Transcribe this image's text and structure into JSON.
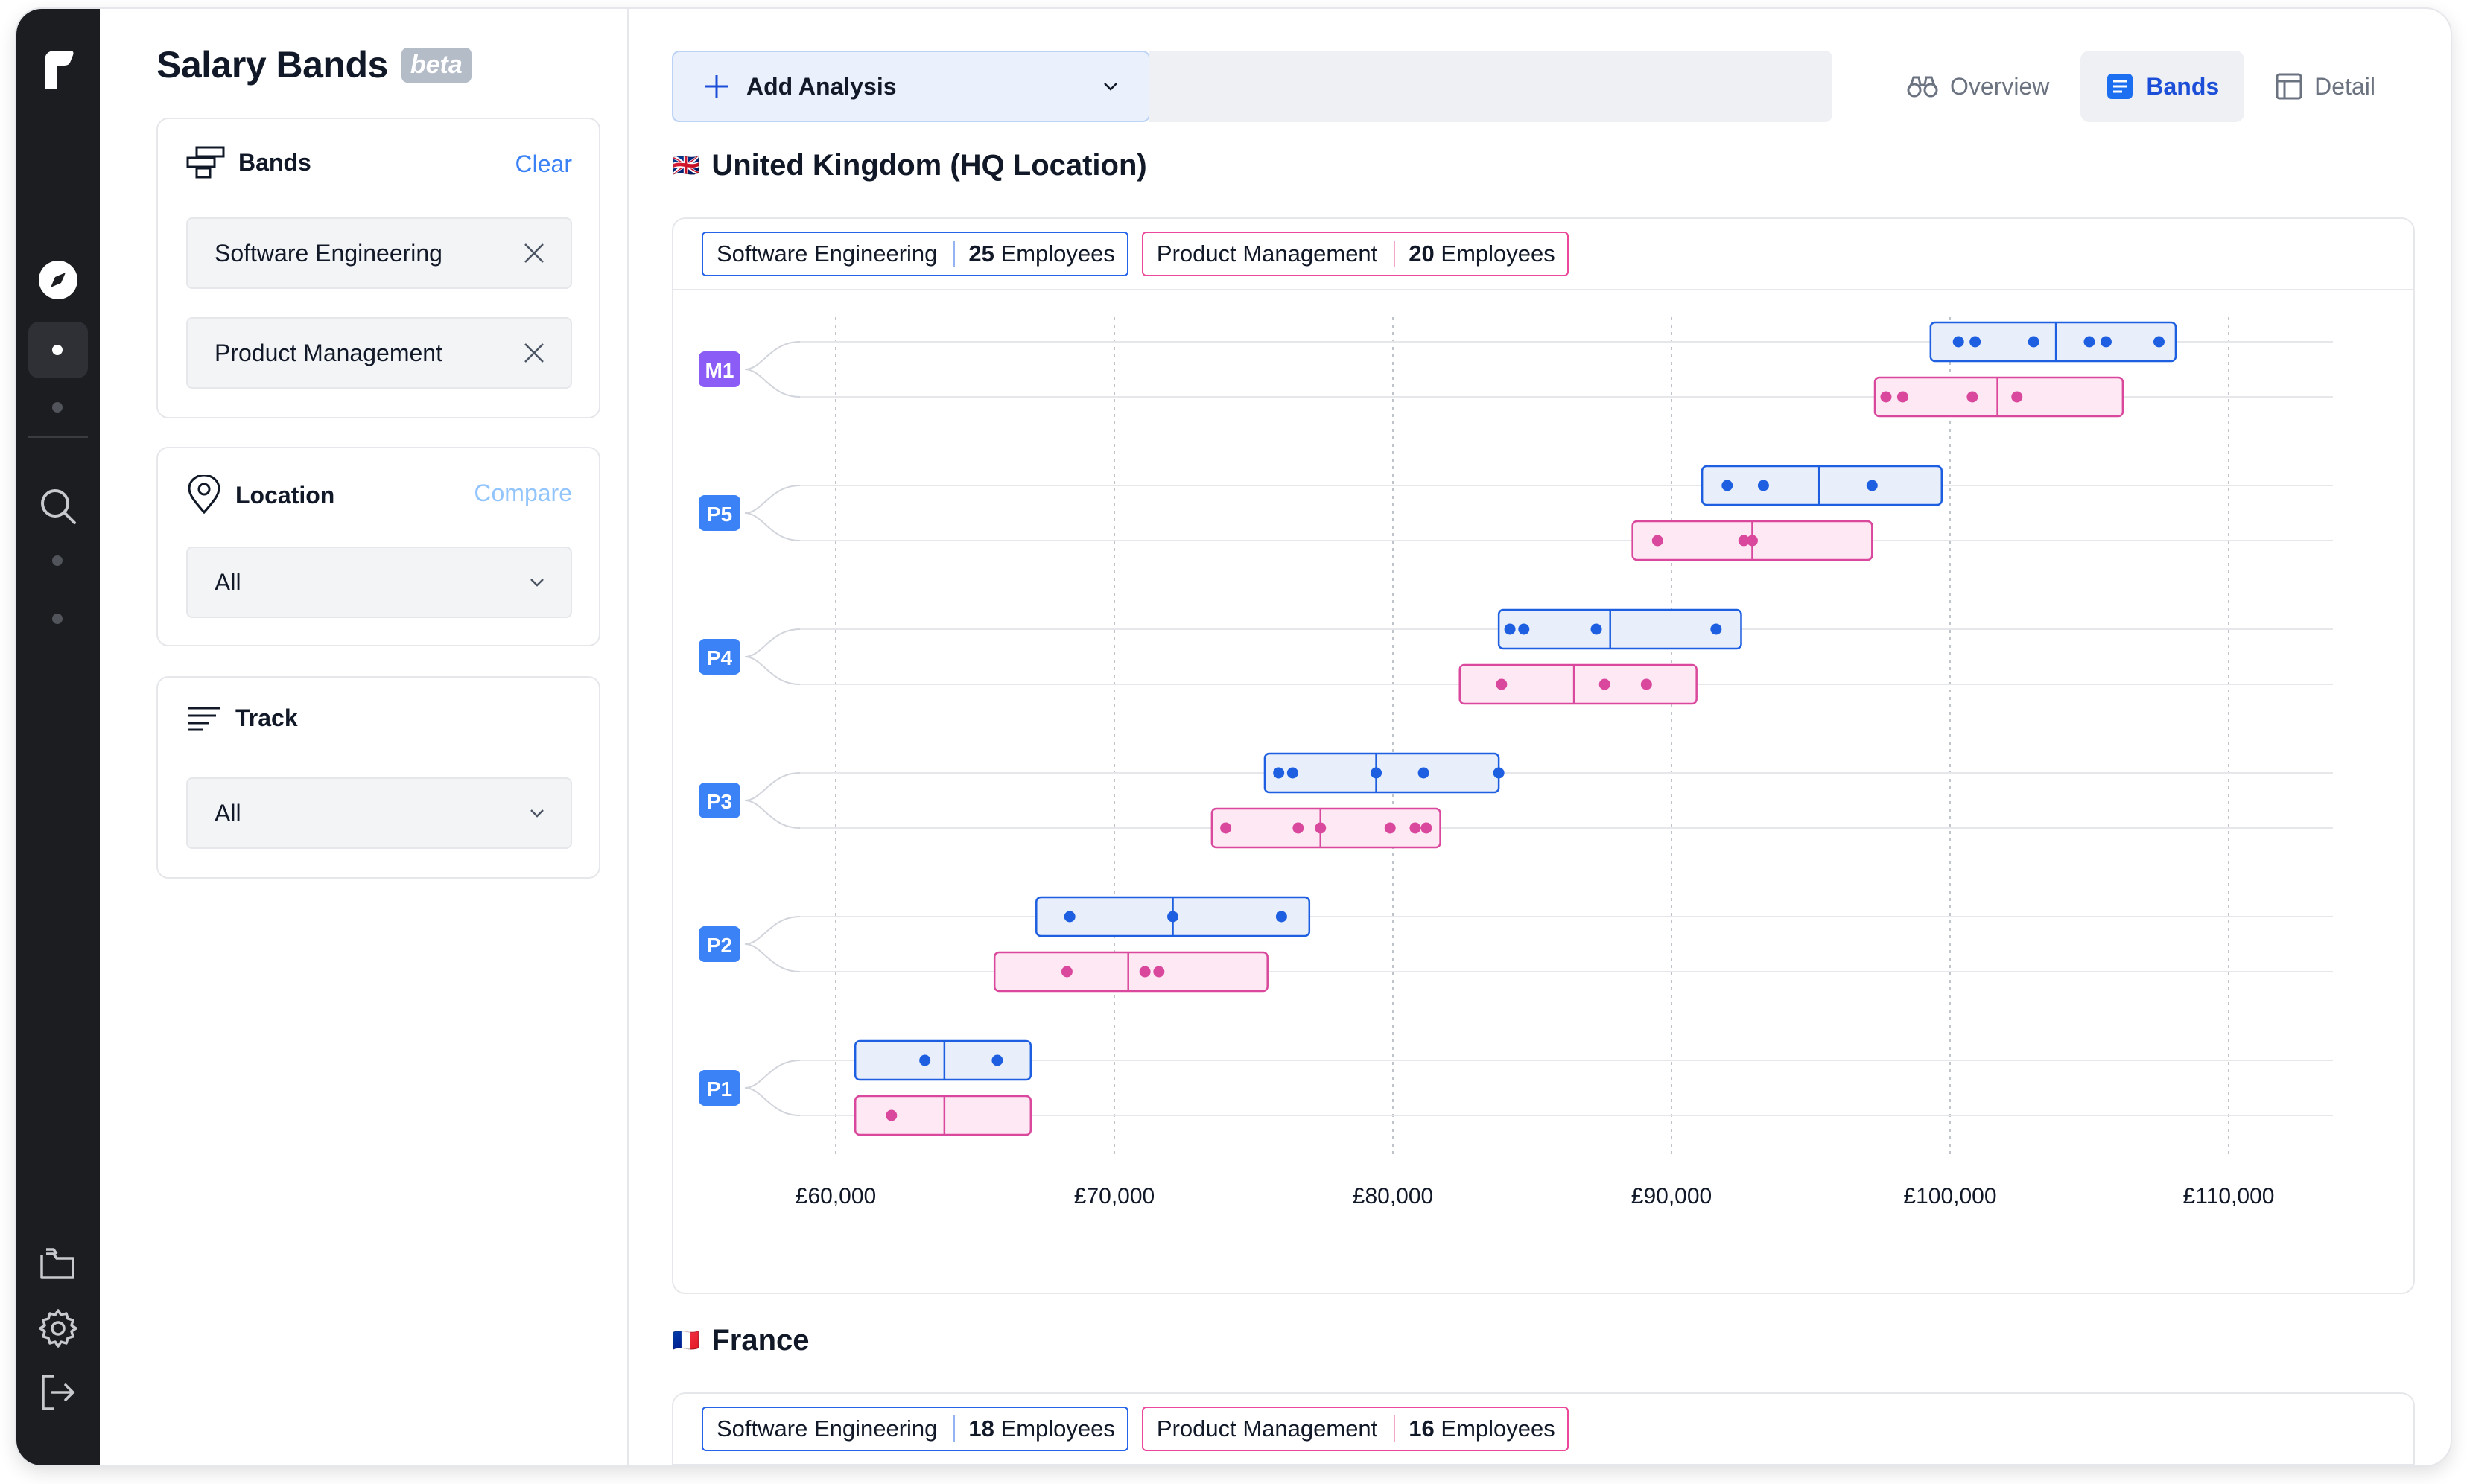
{
  "app": {
    "logo": "r"
  },
  "sidebar": {
    "title": "Salary Bands",
    "badge": "beta",
    "bands_card": {
      "label": "Bands",
      "action": "Clear",
      "items": [
        "Software Engineering",
        "Product Management"
      ]
    },
    "location_card": {
      "label": "Location",
      "action": "Compare",
      "value": "All"
    },
    "track_card": {
      "label": "Track",
      "value": "All"
    }
  },
  "toolbar": {
    "add_label": "Add Analysis",
    "tabs": [
      {
        "label": "Overview",
        "icon": "binoculars-icon"
      },
      {
        "label": "Bands",
        "icon": "document-icon"
      },
      {
        "label": "Detail",
        "icon": "table-icon"
      }
    ],
    "selected_tab": "Bands"
  },
  "sections": [
    {
      "flag": "🇬🇧",
      "title": "United Kingdom (HQ Location)",
      "tags": [
        {
          "name": "Software Engineering",
          "count": "25",
          "unit": "Employees"
        },
        {
          "name": "Product Management",
          "count": "20",
          "unit": "Employees"
        }
      ]
    },
    {
      "flag": "🇫🇷",
      "title": "France",
      "tags": [
        {
          "name": "Software Engineering",
          "count": "18",
          "unit": "Employees"
        },
        {
          "name": "Product Management",
          "count": "16",
          "unit": "Employees"
        }
      ]
    }
  ],
  "colors": {
    "se": "#1d5fe0",
    "se_fill": "#e8effb",
    "pm": "#d9489c",
    "pm_fill": "#fde8f3",
    "level_badge": "#3b82f6",
    "m1_badge": "#8b5cf6"
  },
  "chart_data": {
    "type": "box",
    "title": "United Kingdom (HQ Location)",
    "x_ticks": [
      "£60,000",
      "£70,000",
      "£80,000",
      "£90,000",
      "£100,000",
      "£110,000"
    ],
    "xlim": [
      55000,
      112500
    ],
    "categories": [
      "M1",
      "P5",
      "P4",
      "P3",
      "P2",
      "P1"
    ],
    "series": [
      {
        "name": "Software Engineering",
        "bands": [
          {
            "level": "M1",
            "min": 99300,
            "median": 103800,
            "max": 108100,
            "points": [
              100300,
              100900,
              103000,
              105000,
              105600,
              107500
            ]
          },
          {
            "level": "P5",
            "min": 91100,
            "median": 95300,
            "max": 99700,
            "points": [
              92000,
              93300,
              97200
            ]
          },
          {
            "level": "P4",
            "min": 83800,
            "median": 87800,
            "max": 92500,
            "points": [
              84200,
              84700,
              87300,
              91600
            ]
          },
          {
            "level": "P3",
            "min": 75400,
            "median": 79400,
            "max": 83800,
            "points": [
              75900,
              76400,
              79400,
              81100,
              83800
            ]
          },
          {
            "level": "P2",
            "min": 67200,
            "median": 72100,
            "max": 77000,
            "points": [
              68400,
              72100,
              76000
            ]
          },
          {
            "level": "P1",
            "min": 60700,
            "median": 63900,
            "max": 67000,
            "points": [
              63200,
              65800
            ]
          }
        ]
      },
      {
        "name": "Product Management",
        "bands": [
          {
            "level": "M1",
            "min": 97300,
            "median": 101700,
            "max": 106200,
            "points": [
              97700,
              98300,
              100800,
              102400
            ]
          },
          {
            "level": "P5",
            "min": 88600,
            "median": 92900,
            "max": 97200,
            "points": [
              89500,
              92600,
              92900
            ]
          },
          {
            "level": "P4",
            "min": 82400,
            "median": 86500,
            "max": 90900,
            "points": [
              83900,
              87600,
              89100
            ]
          },
          {
            "level": "P3",
            "min": 73500,
            "median": 77400,
            "max": 81700,
            "points": [
              74000,
              76600,
              77400,
              79900,
              80800,
              81200
            ]
          },
          {
            "level": "P2",
            "min": 65700,
            "median": 70500,
            "max": 75500,
            "points": [
              68300,
              71100,
              71600
            ]
          },
          {
            "level": "P1",
            "min": 60700,
            "median": 63900,
            "max": 67000,
            "points": [
              62000
            ]
          }
        ]
      }
    ]
  }
}
